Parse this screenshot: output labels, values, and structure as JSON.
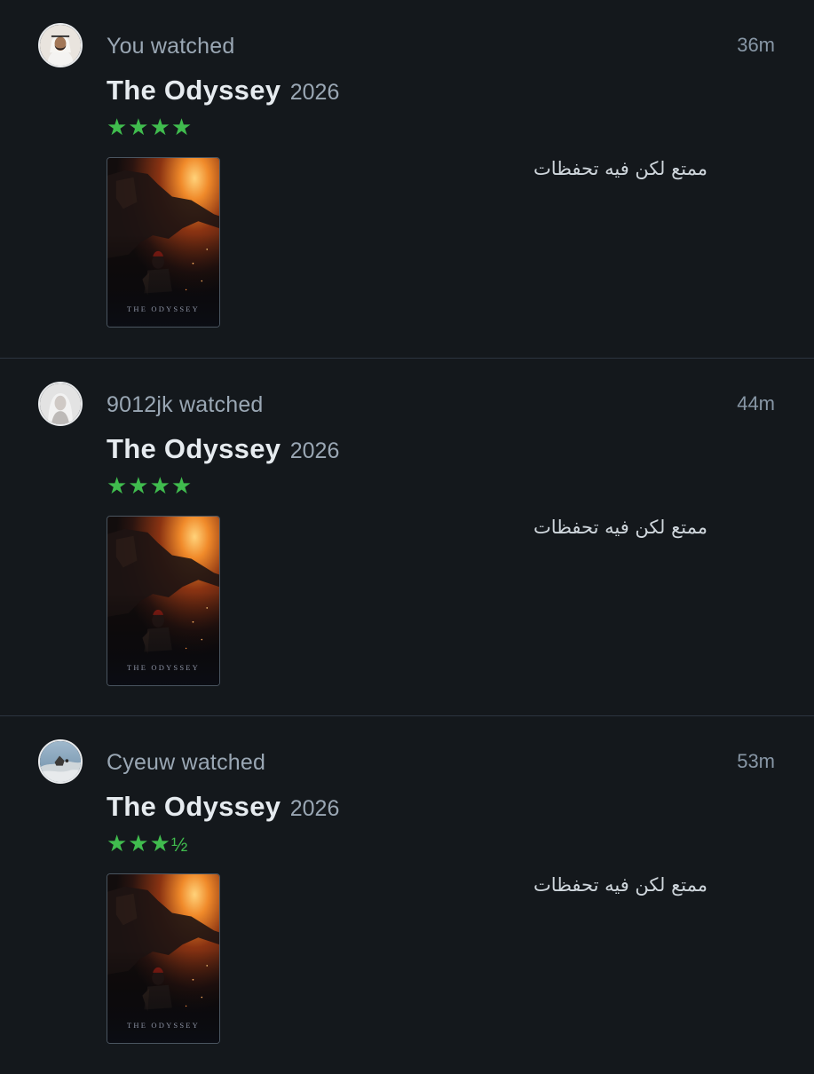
{
  "entries": [
    {
      "watched_text": "You watched",
      "time": "36m",
      "film_title": "The Odyssey",
      "film_year": "2026",
      "stars": "★★★★",
      "rating": 4,
      "poster_text": "THE ODYSSEY",
      "review": "ممتع لكن فيه تحفظات"
    },
    {
      "watched_text": "9012jk watched",
      "time": "44m",
      "film_title": "The Odyssey",
      "film_year": "2026",
      "stars": "★★★★",
      "rating": 4,
      "poster_text": "THE ODYSSEY",
      "review": "ممتع لكن فيه تحفظات"
    },
    {
      "watched_text": "Cyeuw watched",
      "time": "53m",
      "film_title": "The Odyssey",
      "film_year": "2026",
      "stars": "★★★",
      "stars_half": "½",
      "rating": 3.5,
      "poster_text": "THE ODYSSEY",
      "review": "ممتع لكن فيه تحفظات"
    }
  ],
  "colors": {
    "background": "#14181c",
    "star": "#40bc4e",
    "title": "#e6ebef",
    "muted": "#9aa7b4",
    "divider": "#2c3440"
  }
}
